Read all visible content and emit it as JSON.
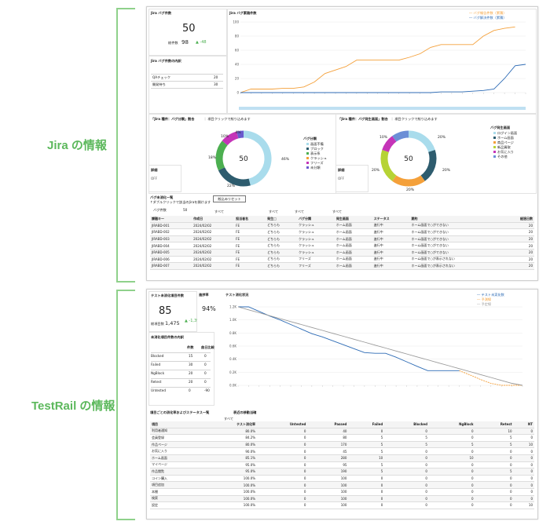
{
  "sections": {
    "jira": "Jira の情報",
    "testrail": "TestRail の情報"
  },
  "colors": {
    "orange": "#f4a03a",
    "blue": "#2d6bb5",
    "green": "#4caf50",
    "teal": "#2e5c6e",
    "lightblue": "#a9dcec",
    "magenta": "#c534b8",
    "gray": "#999999"
  },
  "jira": {
    "bug_count": {
      "title": "Jira バグ件数",
      "value": "50",
      "total_label": "総件数",
      "total": "98",
      "delta": "▲ -48"
    },
    "bug_breakdown": {
      "title": "Jira バグ件数の内訳",
      "rows": [
        {
          "label": "QAチェック",
          "value": "20"
        },
        {
          "label": "開発待ち",
          "value": "30"
        }
      ]
    },
    "cumulative": {
      "title": "Jira バグ累積件数",
      "legend": [
        "バグ報告件数（累積）",
        "バグ解決件数（累積）"
      ],
      "chart_data": {
        "type": "line",
        "ylim": [
          0,
          100
        ],
        "yticks": [
          "0",
          "20",
          "40",
          "60",
          "80",
          "100"
        ],
        "series": [
          {
            "name": "バグ報告件数（累積）",
            "values": [
              0,
              5,
              5,
              5,
              6,
              6,
              8,
              15,
              27,
              32,
              37,
              46,
              46,
              46,
              46,
              46,
              50,
              55,
              64,
              68,
              68,
              68,
              68,
              80,
              88,
              91,
              93
            ]
          },
          {
            "name": "バグ解決件数（累積）",
            "values": [
              0,
              0,
              0,
              0,
              0,
              0,
              0,
              0,
              0,
              0,
              0,
              0,
              0,
              0,
              0,
              0,
              0,
              0,
              0,
              1,
              1,
              1,
              2,
              3,
              5,
              20,
              38,
              40
            ]
          }
        ]
      }
    },
    "donut1": {
      "title": "「Jira 種件：バグ分類」割合",
      "subtitle": "：項目クリックで絞り込めます",
      "center": "50",
      "legend_title": "バグ分類",
      "legend": [
        "画面不備",
        "ブロック",
        "表示系",
        "クラッシュ",
        "フリーズ",
        "未分類"
      ],
      "chart_data": {
        "type": "pie",
        "labels": [
          "画面不備",
          "ブロック",
          "表示系",
          "クラッシュ",
          "フリーズ",
          "未分類"
        ],
        "values": [
          46,
          22,
          18,
          0,
          10,
          4
        ]
      },
      "labels": {
        "p46": "46%",
        "p22": "22%",
        "p18": "18%",
        "p10": "10%",
        "p4": "4%"
      }
    },
    "donut2": {
      "title": "「Jira 種件：バグ発生画面」割合",
      "subtitle": "：項目クリックで絞り込めます",
      "center": "50",
      "legend_title": "バグ発生画面",
      "legend": [
        "ログイン画面",
        "ホーム画面",
        "商品ページ",
        "新品買取",
        "お気に入り",
        "その他"
      ],
      "chart_data": {
        "type": "pie",
        "labels": [
          "ログイン画面",
          "ホーム画面",
          "商品ページ",
          "新品買取",
          "お気に入り",
          "その他"
        ],
        "values": [
          20,
          20,
          20,
          20,
          10,
          10
        ]
      },
      "labels": {
        "a": "20%",
        "b": "20%",
        "c": "20%",
        "d": "20%",
        "e": "10%"
      }
    },
    "filter1": {
      "title": "詳細",
      "value": "OFF"
    },
    "filter2": {
      "title": "詳細",
      "value": "OFF"
    },
    "list": {
      "title": "バグ未消化一覧",
      "subtitle": "↑ダブルクリックで該当のJiraを開けます",
      "reset": "絞込みリセット",
      "count_label": "バグ件数",
      "count": "50",
      "filter_all": "すべて",
      "columns": [
        "課題キー",
        "作成日",
        "担当者名",
        "発生□",
        "バグ分類",
        "発生画面",
        "ステータス",
        "要約",
        "経過日数"
      ],
      "rows": [
        [
          "JIRABD-001",
          "2024/02/02",
          "FE",
          "どちらも",
          "クラッシュ",
          "ホーム画面",
          "進行中",
          "ホーム画面で○ができない",
          "20"
        ],
        [
          "JIRABD-002",
          "2024/02/02",
          "FE",
          "どちらも",
          "クラッシュ",
          "ホーム画面",
          "進行中",
          "ホーム画面で○ができない",
          "20"
        ],
        [
          "JIRABD-003",
          "2024/02/02",
          "FE",
          "どちらも",
          "クラッシュ",
          "ホーム画面",
          "進行中",
          "ホーム画面で○ができない",
          "20"
        ],
        [
          "JIRABD-004",
          "2024/02/02",
          "FE",
          "どちらも",
          "クラッシュ",
          "ホーム画面",
          "進行中",
          "ホーム画面で○ができない",
          "20"
        ],
        [
          "JIRABD-005",
          "2024/02/02",
          "FE",
          "どちらも",
          "クラッシュ",
          "ホーム画面",
          "進行中",
          "ホーム画面で○ができない",
          "20"
        ],
        [
          "JIRABD-006",
          "2024/02/02",
          "FE",
          "どちらも",
          "フリーズ",
          "ホーム画面",
          "進行中",
          "ホーム画面で○が表示されない",
          "20"
        ],
        [
          "JIRABD-007",
          "2024/02/02",
          "FE",
          "どちらも",
          "フリーズ",
          "ホーム画面",
          "進行中",
          "ホーム画面で○が表示されない",
          "20"
        ]
      ]
    }
  },
  "testrail": {
    "unexecuted": {
      "title": "テスト未消化項目件数",
      "value": "85",
      "total_label": "総項目数",
      "total": "1,475",
      "delta": "▲ -1,390"
    },
    "progress": {
      "title": "進捗率",
      "value": "94%"
    },
    "status_breakdown": {
      "title": "未消化項目件数の内訳",
      "col1": "件数",
      "col2": "曲日比較",
      "rows": [
        [
          "Blocked",
          "15",
          "0"
        ],
        [
          "Failed",
          "30",
          "0"
        ],
        [
          "NgBlock",
          "20",
          "0"
        ],
        [
          "Retest",
          "20",
          "0"
        ],
        [
          "Untested",
          "0",
          "-90"
        ]
      ]
    },
    "burndown": {
      "title": "テスト消化状況",
      "legend": [
        "テスト未実化数",
        "予測線",
        "予定線"
      ],
      "chart_data": {
        "type": "line",
        "ylim": [
          0,
          1200
        ],
        "yticks": [
          "0.0K",
          "0.2K",
          "0.4K",
          "0.6K",
          "0.8K",
          "1.0K",
          "1.2K"
        ],
        "series": [
          {
            "name": "テスト未実化数",
            "values": [
              1200,
              1200,
              1130,
              1060,
              1000,
              930,
              860,
              790,
              740,
              680,
              620,
              560,
              500,
              490,
              490,
              430,
              360,
              290,
              225,
              225,
              225,
              225
            ]
          },
          {
            "name": "予測線",
            "values": [
              null,
              null,
              null,
              null,
              null,
              null,
              null,
              null,
              null,
              null,
              null,
              null,
              null,
              null,
              null,
              null,
              null,
              null,
              null,
              null,
              null,
              225,
              160,
              90,
              30,
              0,
              0,
              0
            ]
          },
          {
            "name": "予定線",
            "values": [
              1200,
              1155,
              1110,
              1065,
              1020,
              975,
              930,
              885,
              840,
              795,
              750,
              705,
              660,
              615,
              570,
              525,
              480,
              435,
              390,
              345,
              300,
              255,
              210,
              165,
              120,
              75,
              30,
              0
            ]
          }
        ]
      }
    },
    "table": {
      "title": "項目ごとの消化率およびステータス一覧",
      "subtitle": "表近の移動当確",
      "filter": "すべて",
      "columns": [
        "項目",
        "テスト消化率",
        "Untested",
        "Passed",
        "Failed",
        "Blocked",
        "NgBlock",
        "Retest",
        "NT"
      ],
      "rows": [
        [
          "利用者通知",
          "80.0%",
          "0",
          "40",
          "0",
          "0",
          "0",
          "10",
          "0"
        ],
        [
          "会員登録",
          "84.2%",
          "0",
          "80",
          "5",
          "5",
          "0",
          "5",
          "0"
        ],
        [
          "作品ページ",
          "80.0%",
          "0",
          "170",
          "5",
          "5",
          "5",
          "5",
          "10"
        ],
        [
          "お気に入り",
          "90.0%",
          "0",
          "45",
          "5",
          "0",
          "0",
          "0",
          "0"
        ],
        [
          "ホーム画面",
          "85.1%",
          "0",
          "280",
          "10",
          "0",
          "10",
          "0",
          "0"
        ],
        [
          "マイページ",
          "95.0%",
          "0",
          "95",
          "5",
          "0",
          "0",
          "0",
          "0"
        ],
        [
          "作品閲覧",
          "95.0%",
          "0",
          "190",
          "5",
          "0",
          "0",
          "5",
          "0"
        ],
        [
          "コイン購入",
          "100.0%",
          "0",
          "100",
          "0",
          "0",
          "0",
          "0",
          "0"
        ],
        [
          "項目追加",
          "100.0%",
          "0",
          "100",
          "0",
          "0",
          "0",
          "0",
          "0"
        ],
        [
          "本棚",
          "100.0%",
          "0",
          "100",
          "0",
          "0",
          "0",
          "0",
          "0"
        ],
        [
          "検索",
          "100.0%",
          "0",
          "100",
          "0",
          "0",
          "0",
          "0",
          "0"
        ],
        [
          "設定",
          "100.0%",
          "0",
          "100",
          "0",
          "0",
          "0",
          "0",
          "10"
        ]
      ]
    }
  }
}
